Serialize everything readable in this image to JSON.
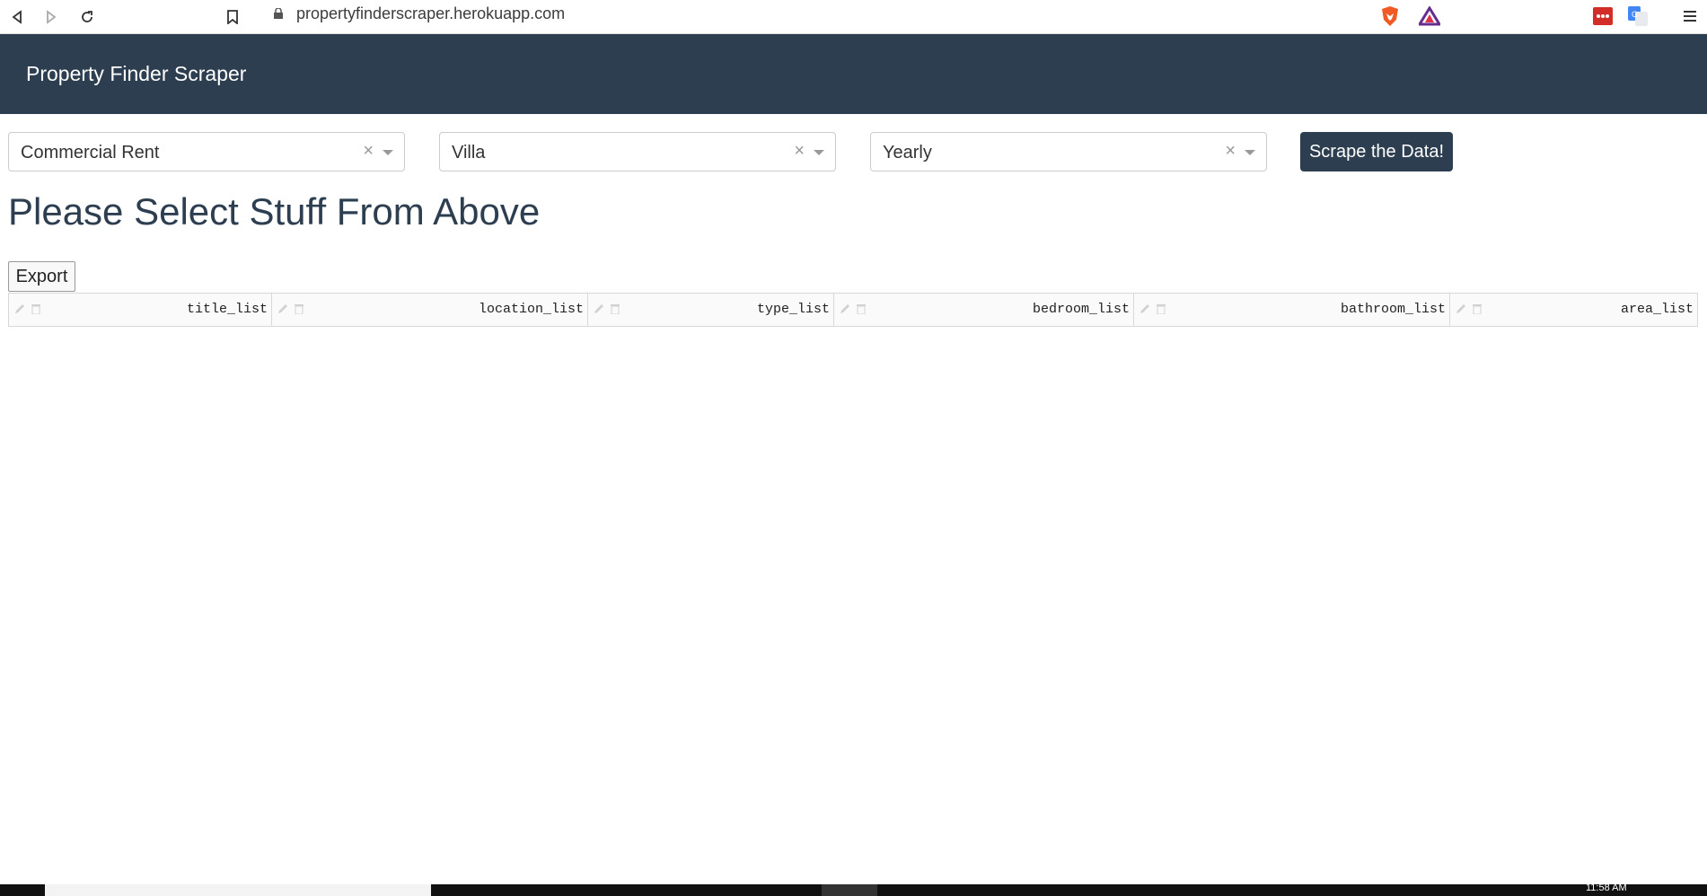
{
  "browser": {
    "url": "propertyfinderscraper.herokuapp.com"
  },
  "header": {
    "title": "Property Finder Scraper",
    "background": "#2c3e50"
  },
  "filters": [
    {
      "value": "Commercial Rent",
      "clear": "×"
    },
    {
      "value": "Villa",
      "clear": "×"
    },
    {
      "value": "Yearly",
      "clear": "×"
    }
  ],
  "actions": {
    "scrape_label": "Scrape the Data!",
    "export_label": "Export"
  },
  "main": {
    "heading": "Please Select Stuff From Above"
  },
  "table": {
    "columns": [
      "title_list",
      "location_list",
      "type_list",
      "bedroom_list",
      "bathroom_list",
      "area_list"
    ]
  },
  "taskbar": {
    "clock": "11:58 AM"
  }
}
